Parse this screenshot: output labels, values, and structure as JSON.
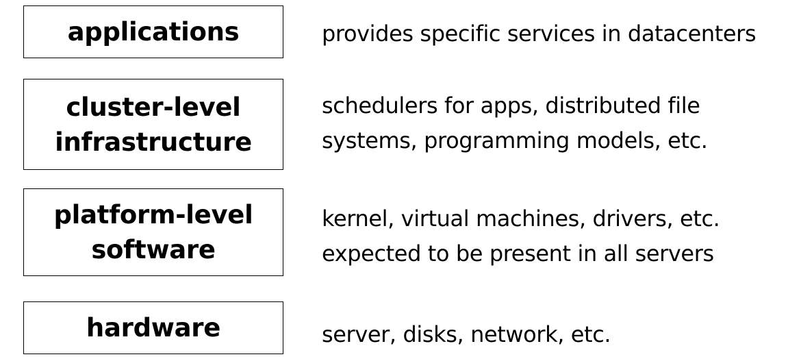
{
  "layers": [
    {
      "name": "applications",
      "description": "provides specific services in datacenters"
    },
    {
      "name": "cluster-level\ninfrastructure",
      "description": "schedulers for apps, distributed file\nsystems, programming models, etc."
    },
    {
      "name": "platform-level\nsoftware",
      "description": "kernel, virtual machines, drivers, etc.\nexpected to be present in all servers"
    },
    {
      "name": "hardware",
      "description": "server, disks, network, etc."
    }
  ]
}
